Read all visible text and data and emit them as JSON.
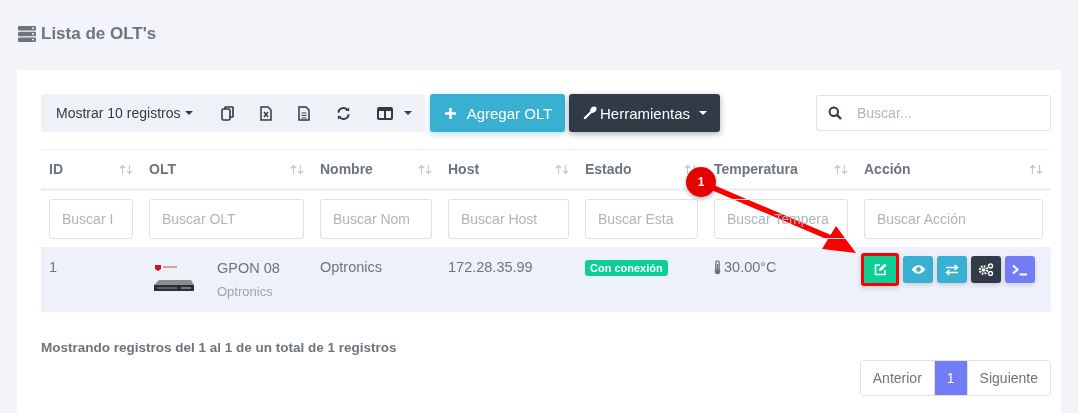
{
  "page_title": "Lista de OLT's",
  "toolbar": {
    "length_menu": "Mostrar 10 registros",
    "export_buttons": [
      {
        "kind": "copy"
      },
      {
        "kind": "excel"
      },
      {
        "kind": "csv"
      },
      {
        "kind": "reload"
      },
      {
        "kind": "columns"
      }
    ],
    "add_button": "Agregar OLT",
    "tools_button": "Herramientas",
    "search": {
      "placeholder": "Buscar..."
    }
  },
  "table": {
    "columns": [
      {
        "label": "ID",
        "filter_placeholder": "Buscar I"
      },
      {
        "label": "OLT",
        "filter_placeholder": "Buscar OLT"
      },
      {
        "label": "Nombre",
        "filter_placeholder": "Buscar Nom"
      },
      {
        "label": "Host",
        "filter_placeholder": "Buscar Host"
      },
      {
        "label": "Estado",
        "filter_placeholder": "Buscar Esta"
      },
      {
        "label": "Temperatura",
        "filter_placeholder": "Buscar Tempera"
      },
      {
        "label": "Acción",
        "filter_placeholder": "Buscar Acción"
      }
    ],
    "rows": [
      {
        "id": "1",
        "olt_name": "GPON 08",
        "olt_brand": "Optronics",
        "nombre": "Optronics",
        "host": "172.28.35.99",
        "estado": "Con conexión",
        "temperatura": "30.00°C",
        "actions": [
          {
            "kind": "edit",
            "highlighted": true
          },
          {
            "kind": "view",
            "highlighted": false
          },
          {
            "kind": "swap",
            "highlighted": false
          },
          {
            "kind": "settings",
            "highlighted": false
          },
          {
            "kind": "terminal",
            "highlighted": false
          }
        ]
      }
    ]
  },
  "info": "Mostrando registros del 1 al 1 de un total de 1 registros",
  "pagination": [
    {
      "label": "Anterior",
      "selected": false
    },
    {
      "label": "1",
      "selected": true
    },
    {
      "label": "Siguiente",
      "selected": false
    }
  ],
  "callout": {
    "number": "1"
  }
}
